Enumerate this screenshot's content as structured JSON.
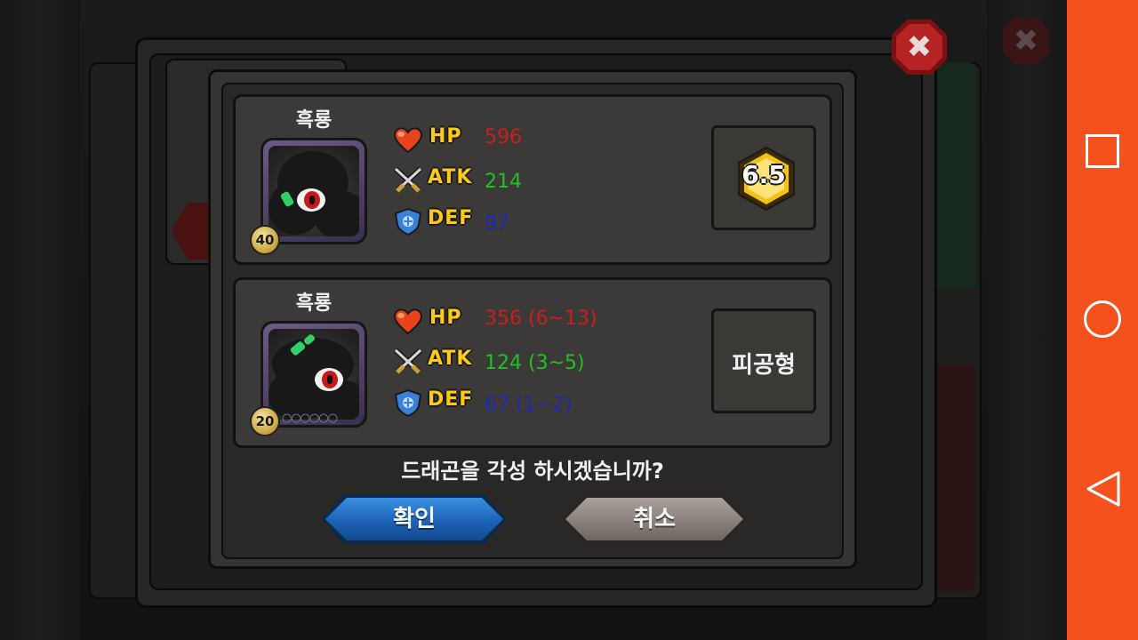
{
  "dialog": {
    "dragons": [
      {
        "name": "흑룡",
        "level": "40",
        "stars": "",
        "stats": {
          "hp_label": "HP",
          "hp": "596",
          "atk_label": "ATK",
          "atk": "214",
          "def_label": "DEF",
          "def": "97"
        },
        "grade": "6.5"
      },
      {
        "name": "흑룡",
        "level": "20",
        "stars": "○○○○○○",
        "stats": {
          "hp_label": "HP",
          "hp": "356 (6~13)",
          "atk_label": "ATK",
          "atk": "124 (3~5)",
          "def_label": "DEF",
          "def": "67 (1~2)"
        },
        "type_label": "피공형"
      }
    ],
    "question": "드래곤을 각성 하시겠습니까?",
    "confirm_label": "확인",
    "cancel_label": "취소"
  },
  "colors": {
    "hp": "#c81e1e",
    "atk": "#1ec11e",
    "def": "#1e29b8",
    "stat_label": "#ffc91a",
    "confirm_button": "#1d63b8",
    "cancel_button": "#8a817a",
    "nav_bar": "#f4511e"
  },
  "icons": {
    "close": "close-icon",
    "hp": "heart-icon",
    "atk": "crossed-swords-icon",
    "def": "shield-icon",
    "nav_recent": "square-icon",
    "nav_home": "circle-icon",
    "nav_back": "triangle-back-icon"
  }
}
